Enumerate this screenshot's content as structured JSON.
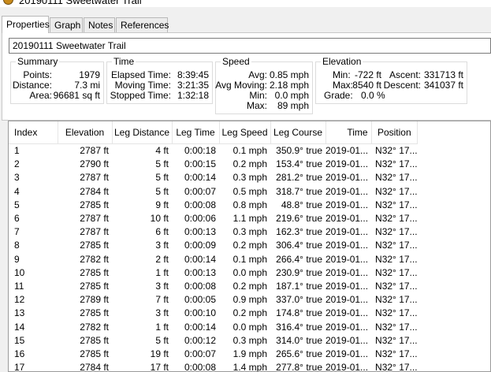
{
  "window": {
    "title": "20190111 Sweetwater Trail"
  },
  "tabs": [
    {
      "label": "Properties",
      "active": true
    },
    {
      "label": "Graph",
      "active": false
    },
    {
      "label": "Notes",
      "active": false
    },
    {
      "label": "References",
      "active": false
    }
  ],
  "track_name": "20190111 Sweetwater Trail",
  "summary": {
    "title": "Summary",
    "rows": [
      {
        "label": "Points:",
        "value": "1979"
      },
      {
        "label": "Distance:",
        "value": "7.3 mi"
      },
      {
        "label": "Area:",
        "value": "96681 sq ft"
      }
    ]
  },
  "time": {
    "title": "Time",
    "rows": [
      {
        "label": "Elapsed Time:",
        "value": "8:39:45"
      },
      {
        "label": "Moving Time:",
        "value": "3:21:35"
      },
      {
        "label": "Stopped Time:",
        "value": "1:32:18"
      }
    ]
  },
  "speed": {
    "title": "Speed",
    "rows": [
      {
        "label": "Avg:",
        "value": "0.85 mph"
      },
      {
        "label": "Avg Moving:",
        "value": "2.18 mph"
      },
      {
        "label": "Min:",
        "value": "0.0 mph"
      },
      {
        "label": "Max:",
        "value": "89 mph"
      }
    ]
  },
  "elevation": {
    "title": "Elevation",
    "min_label": "Min:",
    "min_value": "-722 ft",
    "max_label": "Max:",
    "max_value": "8540 ft",
    "grade_label": "Grade:",
    "grade_value": "0.0 %",
    "ascent_label": "Ascent:",
    "ascent_value": "331713 ft",
    "descent_label": "Descent:",
    "descent_value": "341037 ft"
  },
  "table": {
    "columns": [
      "Index",
      "Elevation",
      "Leg Distance",
      "Leg Time",
      "Leg Speed",
      "Leg Course",
      "Time",
      "Position"
    ],
    "rows": [
      [
        "1",
        "2787 ft",
        "4 ft",
        "0:00:18",
        "0.1 mph",
        "350.9° true",
        "2019-01...",
        "N32° 17..."
      ],
      [
        "2",
        "2790 ft",
        "5 ft",
        "0:00:15",
        "0.2 mph",
        "153.4° true",
        "2019-01...",
        "N32° 17..."
      ],
      [
        "3",
        "2787 ft",
        "5 ft",
        "0:00:14",
        "0.3 mph",
        "281.2° true",
        "2019-01...",
        "N32° 17..."
      ],
      [
        "4",
        "2784 ft",
        "5 ft",
        "0:00:07",
        "0.5 mph",
        "318.7° true",
        "2019-01...",
        "N32° 17..."
      ],
      [
        "5",
        "2785 ft",
        "9 ft",
        "0:00:08",
        "0.8 mph",
        "48.8° true",
        "2019-01...",
        "N32° 17..."
      ],
      [
        "6",
        "2787 ft",
        "10 ft",
        "0:00:06",
        "1.1 mph",
        "219.6° true",
        "2019-01...",
        "N32° 17..."
      ],
      [
        "7",
        "2787 ft",
        "6 ft",
        "0:00:13",
        "0.3 mph",
        "162.3° true",
        "2019-01...",
        "N32° 17..."
      ],
      [
        "8",
        "2785 ft",
        "3 ft",
        "0:00:09",
        "0.2 mph",
        "306.4° true",
        "2019-01...",
        "N32° 17..."
      ],
      [
        "9",
        "2782 ft",
        "2 ft",
        "0:00:14",
        "0.1 mph",
        "266.4° true",
        "2019-01...",
        "N32° 17..."
      ],
      [
        "10",
        "2785 ft",
        "1 ft",
        "0:00:13",
        "0.0 mph",
        "230.9° true",
        "2019-01...",
        "N32° 17..."
      ],
      [
        "11",
        "2785 ft",
        "3 ft",
        "0:00:08",
        "0.2 mph",
        "187.1° true",
        "2019-01...",
        "N32° 17..."
      ],
      [
        "12",
        "2789 ft",
        "7 ft",
        "0:00:05",
        "0.9 mph",
        "337.0° true",
        "2019-01...",
        "N32° 17..."
      ],
      [
        "13",
        "2785 ft",
        "3 ft",
        "0:00:10",
        "0.2 mph",
        "174.8° true",
        "2019-01...",
        "N32° 17..."
      ],
      [
        "14",
        "2782 ft",
        "1 ft",
        "0:00:14",
        "0.0 mph",
        "316.4° true",
        "2019-01...",
        "N32° 17..."
      ],
      [
        "15",
        "2785 ft",
        "5 ft",
        "0:00:12",
        "0.3 mph",
        "314.0° true",
        "2019-01...",
        "N32° 17..."
      ],
      [
        "16",
        "2785 ft",
        "19 ft",
        "0:00:07",
        "1.9 mph",
        "265.6° true",
        "2019-01...",
        "N32° 17..."
      ],
      [
        "17",
        "2784 ft",
        "17 ft",
        "0:00:08",
        "1.4 mph",
        "277.8° true",
        "2019-01...",
        "N32° 17..."
      ]
    ]
  }
}
